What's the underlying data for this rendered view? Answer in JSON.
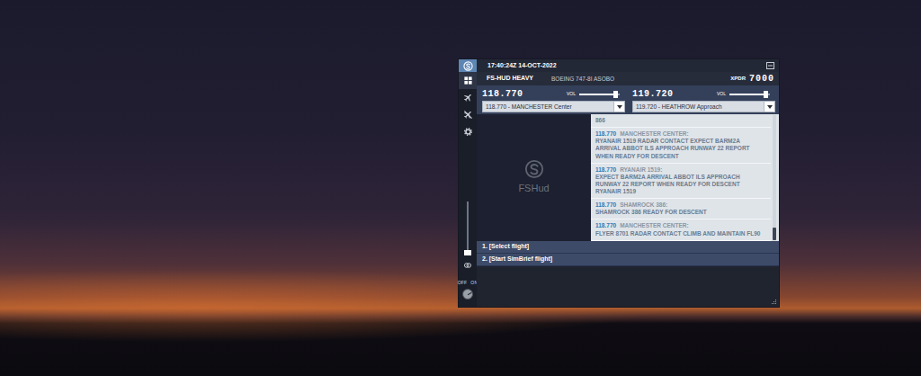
{
  "titlebar": {
    "time": "17:40:24Z 14-OCT-2022"
  },
  "header": {
    "callsign": "FS-HUD HEAVY",
    "aircraft": "BOEING 747-8I ASOBO",
    "xpdr_label": "XPDR",
    "xpdr_code": "7000"
  },
  "sidebar": {
    "items": [
      {
        "kind": "dashboard",
        "selected": true
      },
      {
        "kind": "flight",
        "selected": false
      },
      {
        "kind": "no-flight",
        "selected": false
      },
      {
        "kind": "settings",
        "selected": false
      }
    ],
    "volume": {
      "level": 0.02
    },
    "power": {
      "off_label": "OFF",
      "on_label": "ON",
      "on": true
    }
  },
  "radios": [
    {
      "frequency": "118.770",
      "vol_label": "VOL",
      "level": 0.95,
      "station": "118.770 - MANCHESTER Center"
    },
    {
      "frequency": "119.720",
      "vol_label": "VOL",
      "level": 0.95,
      "station": "119.720 - HEATHROW Approach"
    }
  ],
  "logo": {
    "text": "FSHud"
  },
  "messages": {
    "items": [
      {
        "text": "866"
      },
      {
        "frequency": "118.770",
        "sender": "MANCHESTER CENTER:",
        "text": "RYANAIR 1519 RADAR CONTACT EXPECT BARM2A ARRIVAL ABBOT ILS APPROACH RUNWAY 22 REPORT WHEN READY FOR DESCENT"
      },
      {
        "frequency": "118.770",
        "sender": "RYANAIR 1519:",
        "text": "EXPECT BARM2A ARRIVAL ABBOT ILS APPROACH RUNWAY 22 REPORT WHEN READY FOR DESCENT RYANAIR 1519"
      },
      {
        "frequency": "118.770",
        "sender": "SHAMROCK 386:",
        "text": "SHAMROCK 386 READY FOR DESCENT"
      },
      {
        "frequency": "118.770",
        "sender": "MANCHESTER CENTER:",
        "text": "FLYER 8701 RADAR CONTACT CLIMB AND MAINTAIN FL90"
      }
    ],
    "scroll": {
      "level": 1
    }
  },
  "menu": [
    {
      "label": "1. [Select flight]"
    },
    {
      "label": "2. [Start SimBrief flight]"
    }
  ]
}
